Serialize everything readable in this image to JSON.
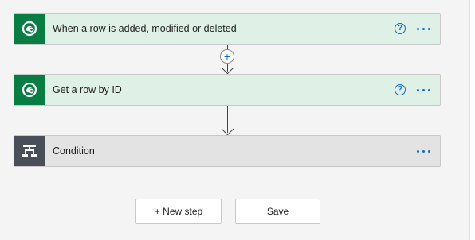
{
  "flow": {
    "steps": [
      {
        "title": "When a row is added, modified or deleted",
        "help_label": "?",
        "icon": "dataverse-icon"
      },
      {
        "title": "Get a row by ID",
        "help_label": "?",
        "icon": "dataverse-icon"
      },
      {
        "title": "Condition",
        "icon": "condition-icon"
      }
    ],
    "insert_step_label": "+"
  },
  "actions": {
    "new_step_label": "+ New step",
    "save_label": "Save"
  },
  "colors": {
    "dataverse_green": "#087d43",
    "condition_dark": "#484f58",
    "action_card_bg": "#dff0e6",
    "condition_card_bg": "#e3e3e3",
    "accent_blue": "#0f6cbd"
  }
}
